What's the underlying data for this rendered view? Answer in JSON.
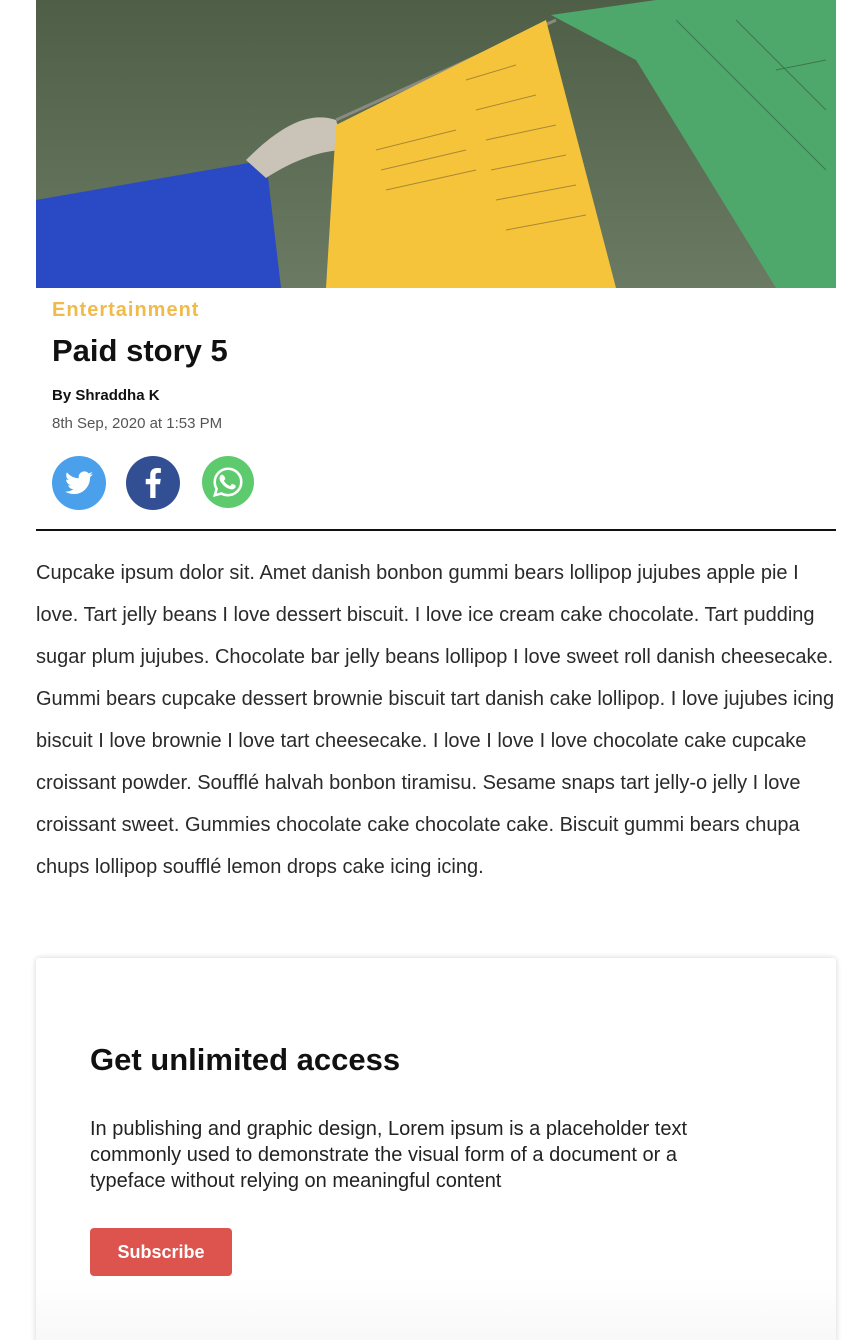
{
  "hero": {
    "image_alt": "prayer flags over water",
    "colors": {
      "water": "#5d6e57",
      "blue_flag": "#2a49c4",
      "yellow_flag": "#f5c43a",
      "green_flag": "#4fa86b"
    }
  },
  "article": {
    "category": "Entertainment",
    "title": "Paid story 5",
    "byline_prefix": "By",
    "author": "Shraddha K",
    "date": "8th Sep, 2020 at 1:53 PM",
    "body": "Cupcake ipsum dolor sit. Amet danish bonbon gummi bears lollipop jujubes apple pie I love. Tart jelly beans I love dessert biscuit. I love ice cream cake chocolate. Tart pudding sugar plum jujubes. Chocolate bar jelly beans lollipop I love sweet roll danish cheesecake. Gummi bears cupcake dessert brownie biscuit tart danish cake lollipop. I love jujubes icing biscuit I love brownie I love tart cheesecake. I love I love I love chocolate cake cupcake croissant powder. Soufflé halvah bonbon tiramisu. Sesame snaps tart jelly-o jelly I love croissant sweet. Gummies chocolate cake chocolate cake. Biscuit gummi bears chupa chups lollipop soufflé lemon drops cake icing icing."
  },
  "share": {
    "buttons": [
      {
        "icon": "twitter-icon",
        "color": "#4aa0ea"
      },
      {
        "icon": "facebook-icon",
        "color": "#334f94"
      },
      {
        "icon": "whatsapp-icon",
        "color": "#5dcb6d"
      }
    ]
  },
  "paywall": {
    "title": "Get unlimited access",
    "description": "In publishing and graphic design, Lorem ipsum is a placeholder text commonly used to demonstrate the visual form of a document or a typeface without relying on meaningful content",
    "button_label": "Subscribe",
    "button_color": "#dd534e"
  },
  "colors": {
    "category": "#f0bb4a",
    "divider": "#111111"
  }
}
